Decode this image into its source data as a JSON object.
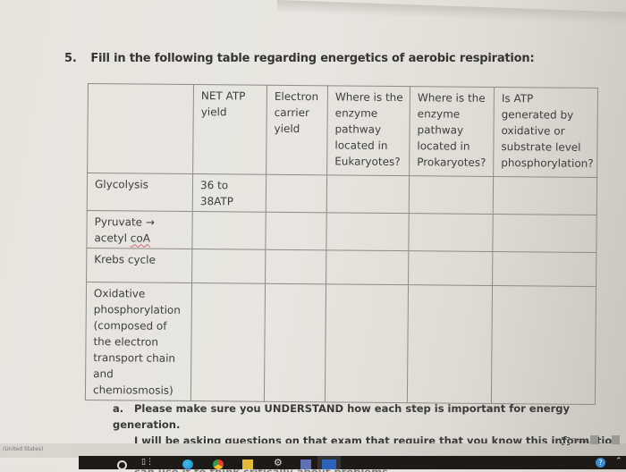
{
  "question": {
    "number": "5.",
    "text": "Fill in the following table regarding energetics of aerobic respiration:"
  },
  "table": {
    "headers": [
      "",
      "NET ATP yield",
      "Electron carrier yield",
      "Where is the enzyme pathway located in Eukaryotes?",
      "Where is the enzyme pathway located in Prokaryotes?",
      "Is ATP generated by oxidative or substrate level phosphorylation?"
    ],
    "rows": [
      {
        "stage": "Glycolysis",
        "cells": [
          "36 to 38ATP",
          "",
          "",
          "",
          ""
        ]
      },
      {
        "stage_part1": "Pyruvate → acetyl ",
        "stage_part2": "coA",
        "cells": [
          "",
          "",
          "",
          "",
          ""
        ]
      },
      {
        "stage": "Krebs cycle",
        "cells": [
          "",
          "",
          "",
          "",
          ""
        ]
      },
      {
        "stage": "Oxidative phosphorylation (composed of the electron transport chain and chemiosmosis)",
        "cells": [
          "",
          "",
          "",
          "",
          ""
        ]
      }
    ]
  },
  "note": {
    "label": "a.",
    "line1": "Please make sure you UNDERSTAND how each step is important for energy generation.",
    "line2": "I will be asking questions on that exam that require that you know this information and",
    "line3": "can use it to think critically about problems."
  },
  "statusbar": {
    "language": "(United States)",
    "focus_label": "Focus"
  },
  "taskbar": {
    "icons": [
      "search-icon",
      "task-view-icon",
      "edge-icon",
      "chrome-icon",
      "file-explorer-icon",
      "settings-icon",
      "app-icon",
      "word-icon",
      "help-icon",
      "chevron-up-icon"
    ]
  }
}
